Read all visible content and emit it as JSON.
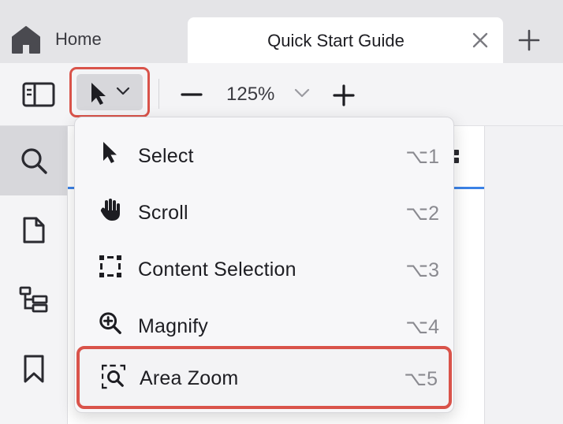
{
  "tabs": {
    "home_label": "Home",
    "active_label": "Quick Start Guide"
  },
  "toolbar": {
    "zoom_level": "125%",
    "icons": [
      "sidebar-toggle-icon",
      "pointer-icon",
      "chevron-down-icon",
      "minus-icon",
      "plus-icon"
    ]
  },
  "sidebar": {
    "items": [
      "search-icon",
      "document-icon",
      "outline-icon",
      "bookmark-icon"
    ]
  },
  "menu": {
    "items": [
      {
        "label": "Select",
        "shortcut": "⌥1",
        "icon": "pointer-icon"
      },
      {
        "label": "Scroll",
        "shortcut": "⌥2",
        "icon": "hand-icon"
      },
      {
        "label": "Content Selection",
        "shortcut": "⌥3",
        "icon": "selection-marquee-icon"
      },
      {
        "label": "Magnify",
        "shortcut": "⌥4",
        "icon": "magnify-plus-icon"
      },
      {
        "label": "Area Zoom",
        "shortcut": "⌥5",
        "icon": "area-zoom-icon"
      }
    ]
  },
  "colors": {
    "highlight_border": "#d9534a",
    "accent_blue": "#3b82e6",
    "text": "#1d1d22",
    "shortcut_text": "#8a8a90"
  }
}
